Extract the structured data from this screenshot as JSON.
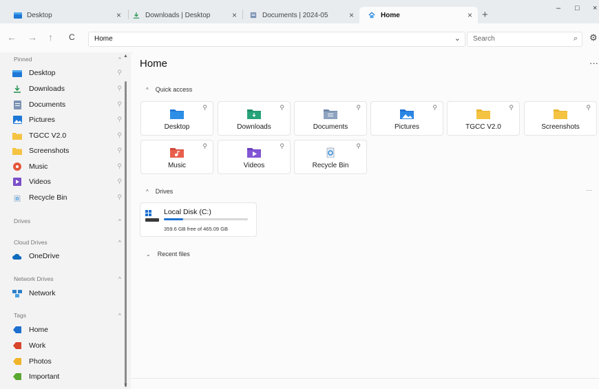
{
  "tabs": [
    {
      "label": "Desktop",
      "icon": "desktop-folder-icon"
    },
    {
      "label": "Downloads | Desktop",
      "icon": "download-arrow-icon"
    },
    {
      "label": "Documents | 2024-05",
      "icon": "documents-folder-icon"
    },
    {
      "label": "Home",
      "icon": "home-icon",
      "active": true
    }
  ],
  "tab_close": "×",
  "new_tab": "+",
  "window_controls": {
    "minimize": "–",
    "maximize": "□",
    "close": "×"
  },
  "nav": {
    "back": "←",
    "forward": "→",
    "up": "↑",
    "refresh": "C"
  },
  "address": {
    "path": "Home",
    "chevron": "⌄"
  },
  "search": {
    "placeholder": "Search",
    "icon": "⌕"
  },
  "settings_icon": "⚙",
  "sidebar": {
    "pinned_header": "Pinned",
    "pinned": [
      {
        "label": "Desktop",
        "icon": "desktop-folder-icon"
      },
      {
        "label": "Downloads",
        "icon": "download-arrow-icon"
      },
      {
        "label": "Documents",
        "icon": "document-icon"
      },
      {
        "label": "Pictures",
        "icon": "pictures-icon"
      },
      {
        "label": "TGCC V2.0",
        "icon": "folder-icon"
      },
      {
        "label": "Screenshots",
        "icon": "folder-icon"
      },
      {
        "label": "Music",
        "icon": "music-icon"
      },
      {
        "label": "Videos",
        "icon": "videos-icon"
      },
      {
        "label": "Recycle Bin",
        "icon": "recycle-bin-icon"
      }
    ],
    "drives_header": "Drives",
    "cloud_header": "Cloud Drives",
    "cloud": [
      {
        "label": "OneDrive",
        "icon": "cloud-icon"
      }
    ],
    "network_header": "Network Drives",
    "network": [
      {
        "label": "Network",
        "icon": "network-icon"
      }
    ],
    "tags_header": "Tags",
    "tags": [
      {
        "label": "Home",
        "color": "#1e6fd0"
      },
      {
        "label": "Work",
        "color": "#d8452b"
      },
      {
        "label": "Photos",
        "color": "#f0b429"
      },
      {
        "label": "Important",
        "color": "#5aa832"
      }
    ]
  },
  "main": {
    "title": "Home",
    "more": "···",
    "quick_access_header": "Quick access",
    "quick_access": [
      {
        "label": "Desktop",
        "icon": "desktop-folder-icon"
      },
      {
        "label": "Downloads",
        "icon": "downloads-folder-icon"
      },
      {
        "label": "Documents",
        "icon": "documents-folder-icon"
      },
      {
        "label": "Pictures",
        "icon": "pictures-folder-icon"
      },
      {
        "label": "TGCC V2.0",
        "icon": "folder-icon"
      },
      {
        "label": "Screenshots",
        "icon": "folder-icon"
      },
      {
        "label": "Music",
        "icon": "music-folder-icon"
      },
      {
        "label": "Videos",
        "icon": "videos-folder-icon"
      },
      {
        "label": "Recycle Bin",
        "icon": "recycle-bin-icon"
      }
    ],
    "drives_header": "Drives",
    "drive": {
      "name": "Local Disk (C:)",
      "free_text": "359.6 GB free of 465.09 GB",
      "used_fraction": 0.227
    },
    "recent_header": "Recent files"
  },
  "pin_glyph": "⚲",
  "colors": {
    "accent": "#1e70d0",
    "folder_yellow": "#f5c342",
    "sidebar_bg": "#f3f3f3",
    "main_bg": "#fbfbfb"
  }
}
